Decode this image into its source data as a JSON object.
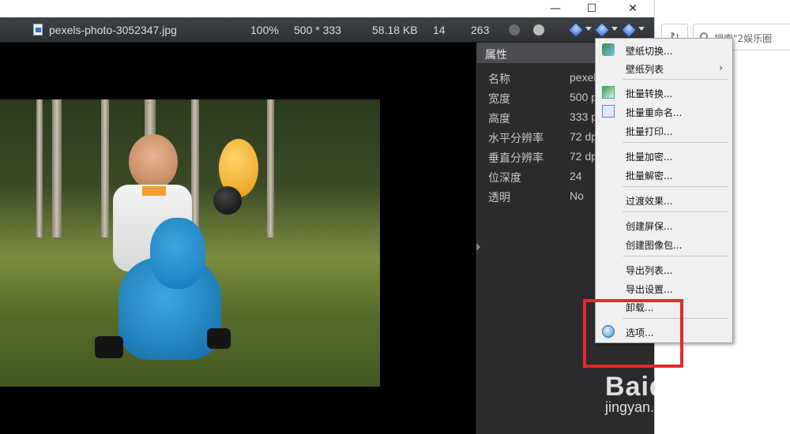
{
  "window": {
    "controls": {
      "minimize": "—",
      "maximize": "☐",
      "close": "✕"
    }
  },
  "infobar": {
    "filename": "pexels-photo-3052347.jpg",
    "zoom": "100%",
    "dimensions": "500 * 333",
    "filesize": "58.18 KB",
    "index": "14",
    "count": "263"
  },
  "properties": {
    "title": "属性",
    "rows": [
      {
        "label": "名称",
        "value": "pexel"
      },
      {
        "label": "宽度",
        "value": "500 p"
      },
      {
        "label": "高度",
        "value": "333 p"
      },
      {
        "label": "水平分辨率",
        "value": "72 dp"
      },
      {
        "label": "垂直分辨率",
        "value": "72 dp"
      },
      {
        "label": "位深度",
        "value": "24"
      },
      {
        "label": "透明",
        "value": "No"
      }
    ]
  },
  "menu": {
    "items": [
      {
        "label": "壁纸切换...",
        "icon": "wallpaper-icon"
      },
      {
        "label": "壁纸列表",
        "submenu": "›"
      },
      {
        "label": "批量转换...",
        "icon": "convert-icon"
      },
      {
        "label": "批量重命名...",
        "icon": "rename-icon"
      },
      {
        "label": "批量打印..."
      },
      {
        "label": "批量加密..."
      },
      {
        "label": "批量解密..."
      },
      {
        "label": "过渡效果..."
      },
      {
        "label": "创建屏保..."
      },
      {
        "label": "创建图像包..."
      },
      {
        "label": "导出列表..."
      },
      {
        "label": "导出设置..."
      },
      {
        "label": "卸载..."
      },
      {
        "label": "选项...",
        "icon": "options-icon"
      }
    ]
  },
  "browser": {
    "refresh_glyph": "↻",
    "search_text": "搜索\"2娱乐圈"
  },
  "watermark": {
    "logo": "Baidu经验",
    "sub": "jingyan.baidu.com"
  },
  "colors": {
    "highlight": "#e8262a",
    "panel_bg": "#2b2b2d",
    "menu_bg": "#f0f0f0"
  }
}
